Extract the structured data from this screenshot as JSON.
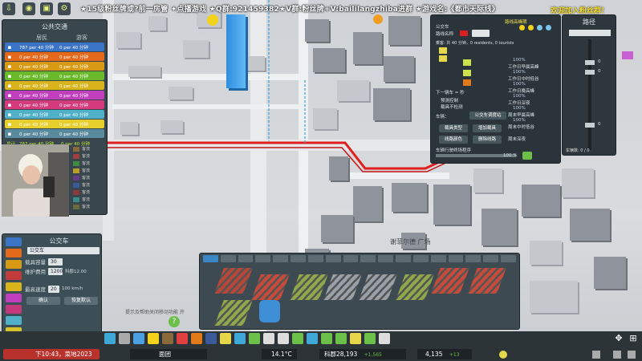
{
  "banner": {
    "text": "★15级粉丝牌或?前一房管 ✦点播游戏 ★Q群:921459382★V群:粉丝牌+V:baililangzhiba进群 ★游戏名:《都市天际线》",
    "right_text": "欢迎加入粉丝群！"
  },
  "transit": {
    "title": "公共交通",
    "col_residents": "居民",
    "col_tourists": "游客",
    "rows": [
      {
        "icon": "bus-icon",
        "color": "#3a74c6",
        "residents": "787 per 40 分钟",
        "tourists": "0 per 40 分钟"
      },
      {
        "icon": "trolley-icon",
        "color": "#e5691a",
        "residents": "0 per 40 分钟",
        "tourists": "0 per 40 分钟"
      },
      {
        "icon": "tram-icon",
        "color": "#d89a14",
        "residents": "0 per 40 分钟",
        "tourists": "0 per 40 分钟"
      },
      {
        "icon": "metro-icon",
        "color": "#6ab92b",
        "residents": "0 per 40 分钟",
        "tourists": "0 per 40 分钟"
      },
      {
        "icon": "train-icon",
        "color": "#d8b31b",
        "residents": "0 per 40 分钟",
        "tourists": "0 per 40 分钟"
      },
      {
        "icon": "monorail-icon",
        "color": "#c13fbd",
        "residents": "0 per 40 分钟",
        "tourists": "0 per 40 分钟"
      },
      {
        "icon": "ship-icon",
        "color": "#d43a7c",
        "residents": "0 per 40 分钟",
        "tourists": "0 per 40 分钟"
      },
      {
        "icon": "plane-icon",
        "color": "#4fb0c8",
        "residents": "0 per 40 分钟",
        "tourists": "0 per 40 分钟"
      },
      {
        "icon": "taxi-icon",
        "color": "#e6cf2d",
        "residents": "0 per 40 分钟",
        "tourists": "0 per 40 分钟"
      },
      {
        "icon": "cable-icon",
        "color": "#5a8a9e",
        "residents": "0 per 40 分钟",
        "tourists": "0 per 40 分钟"
      }
    ],
    "total_label": "总计",
    "total_residents": "787 per 40 分钟",
    "total_tourists": "0 per 40 分钟",
    "legend_title": "流量图例",
    "legend": [
      {
        "label": "客流",
        "color": "#8a6a3a"
      },
      {
        "label": "客流",
        "color": "#a04040"
      },
      {
        "label": "客流",
        "color": "#3c8c3c"
      },
      {
        "label": "客流",
        "color": "#b8a028"
      },
      {
        "label": "客流",
        "color": "#6a3a8a"
      },
      {
        "label": "客流",
        "color": "#3a5a9a"
      },
      {
        "label": "客流",
        "color": "#8a3a3a"
      },
      {
        "label": "客流",
        "color": "#3a8a8a"
      },
      {
        "label": "客流",
        "color": "#6a6a3a"
      }
    ]
  },
  "bus_panel": {
    "title": "公交车",
    "vehicle_select": "公交车",
    "capacity_label": "载具容量",
    "capacity_value": "30",
    "maintenance_label": "维护费用",
    "maintenance_value": "1200",
    "maintenance_unit": "科郡12.00",
    "speed_label": "最高速度",
    "speed_value": "20",
    "speed_unit": "100 km/h",
    "confirm": "确认",
    "restore": "恢复默认"
  },
  "line_panel": {
    "title": "公交车",
    "line_name_label": "路线名称",
    "stats_text": "乘客: 共 40 分钟，0 residents, 0 tourists",
    "schedule_title": "路线高峰期",
    "schedule_labels": [
      "工作日早晨高峰",
      "工作日中时低谷",
      "工作日晚高峰",
      "工作日深夜",
      "周末早晨高峰",
      "周末中时低谷",
      "周末深夜"
    ],
    "percent_labels": [
      "100%",
      "100%",
      "100%",
      "100%",
      "100%",
      "100%"
    ],
    "next_label": "下一辆车 = 秒",
    "option1": "预测控制",
    "option2": "载具不检测",
    "vehicles_label": "车辆：",
    "depot_button": "公交车调度站",
    "btn_stats": "载具类型",
    "btn_add": "增加载具",
    "btn_route": "线路颜色",
    "btn_delete": "删除线路",
    "ratio_label": "车辆行驶终场程序",
    "ratio_value": "100 %",
    "vehicle_count": "车辆数: 0 / 0"
  },
  "speed_panel": {
    "title": "路径",
    "labels": [
      "0",
      "0",
      "0"
    ],
    "bottom_label": "车辆数: 0 / 0"
  },
  "map": {
    "plaza_label": "谢菲尔德 广场",
    "hint": "提示及帮助关闭移动功能 开"
  },
  "road_palette": {
    "tabs": 18
  },
  "bottom": {
    "date": "下10:43，菜地2023",
    "info_view": "面团",
    "temperature": "14.1°C",
    "money": "科郡28,193",
    "income": "+1,565",
    "population": "4,135",
    "population_change": "+13"
  },
  "colors": {
    "accent_green": "#c2eb2f",
    "line_red": "#e01e1e",
    "panel_bg": "#2f3a40"
  }
}
